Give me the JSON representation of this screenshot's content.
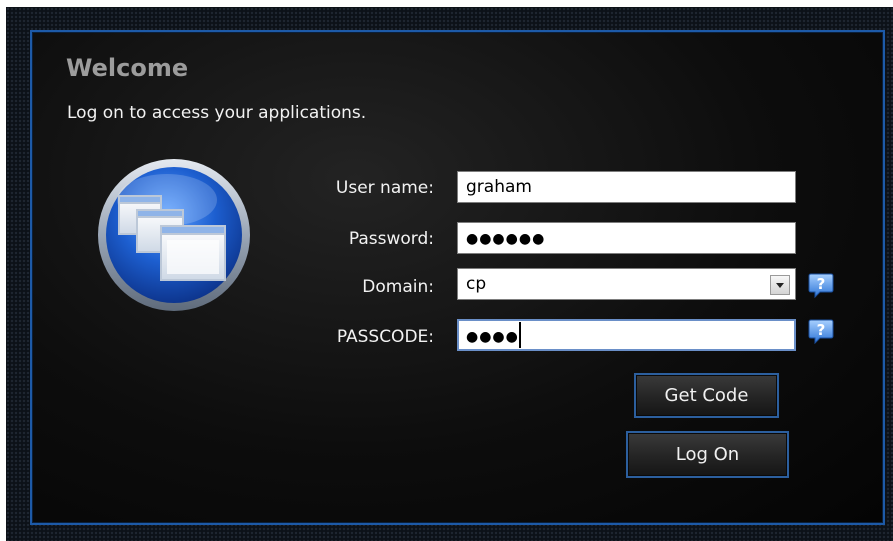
{
  "header": {
    "title": "Welcome",
    "subtitle": "Log on to access your applications."
  },
  "logo": {
    "icon": "application-windows-icon",
    "colors": {
      "rim": "#b8c4d4",
      "face": "#1d5fd0",
      "highlight": "#6ea8ff"
    }
  },
  "form": {
    "username_label": "User name:",
    "username_value": "graham",
    "password_label": "Password:",
    "password_value": "●●●●●●",
    "domain_label": "Domain:",
    "domain_value": "cp",
    "passcode_label": "PASSCODE:",
    "passcode_value": "●●●●"
  },
  "help": {
    "domain_icon": "help-icon",
    "passcode_icon": "help-icon"
  },
  "buttons": {
    "get_code_label": "Get Code",
    "log_on_label": "Log On"
  },
  "colors": {
    "accent": "#1d5aa8",
    "label_text": "#f2f2f2",
    "title_text": "#9c9c9c"
  }
}
